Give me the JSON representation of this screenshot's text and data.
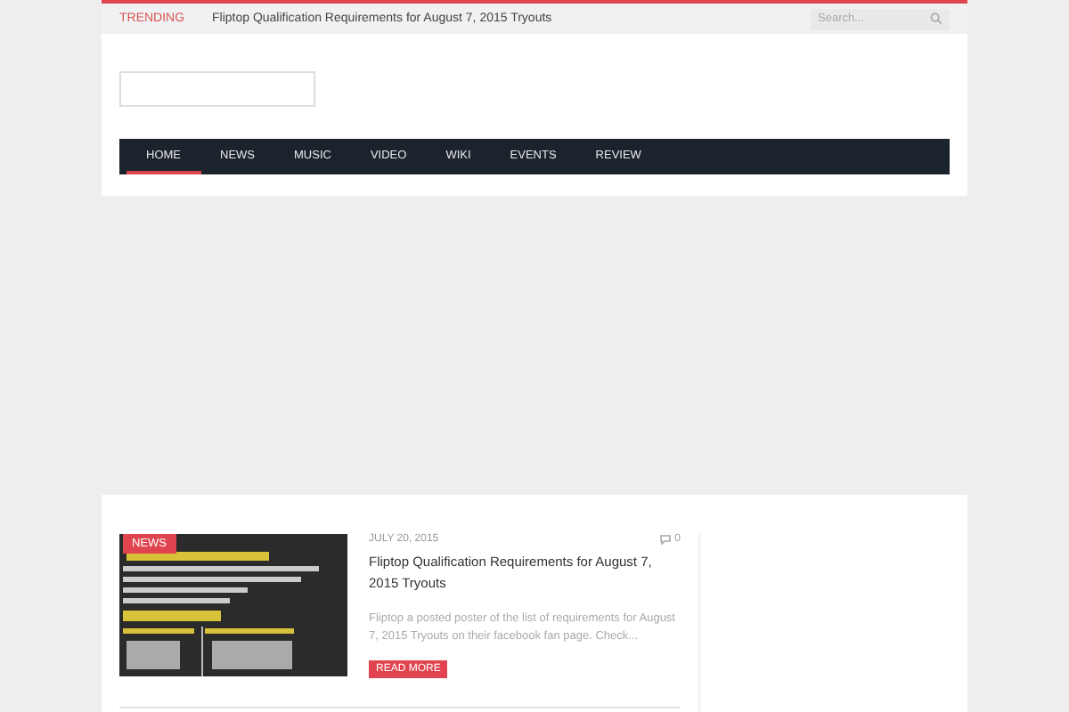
{
  "top_bar": {
    "trending_label": "TRENDING",
    "trending_title": "Fliptop Qualification Requirements for August 7, 2015 Tryouts",
    "search": {
      "placeholder": "Search..."
    }
  },
  "nav": {
    "items": [
      {
        "label": "HOME",
        "selected": true
      },
      {
        "label": "NEWS",
        "selected": false
      },
      {
        "label": "MUSIC",
        "selected": false
      },
      {
        "label": "VIDEO",
        "selected": false
      },
      {
        "label": "WIKI",
        "selected": false
      },
      {
        "label": "EVENTS",
        "selected": false
      },
      {
        "label": "REVIEW",
        "selected": false
      }
    ]
  },
  "posts": [
    {
      "category": "NEWS",
      "date": "JULY 20, 2015",
      "comments": "0",
      "title": "Fliptop Qualification Requirements for August 7, 2015 Tryouts",
      "excerpt": "Fliptop a posted poster of the list of requirements for August 7, 2015 Tryouts on their facebook fan page. Check...",
      "button": "READ MORE"
    }
  ]
}
